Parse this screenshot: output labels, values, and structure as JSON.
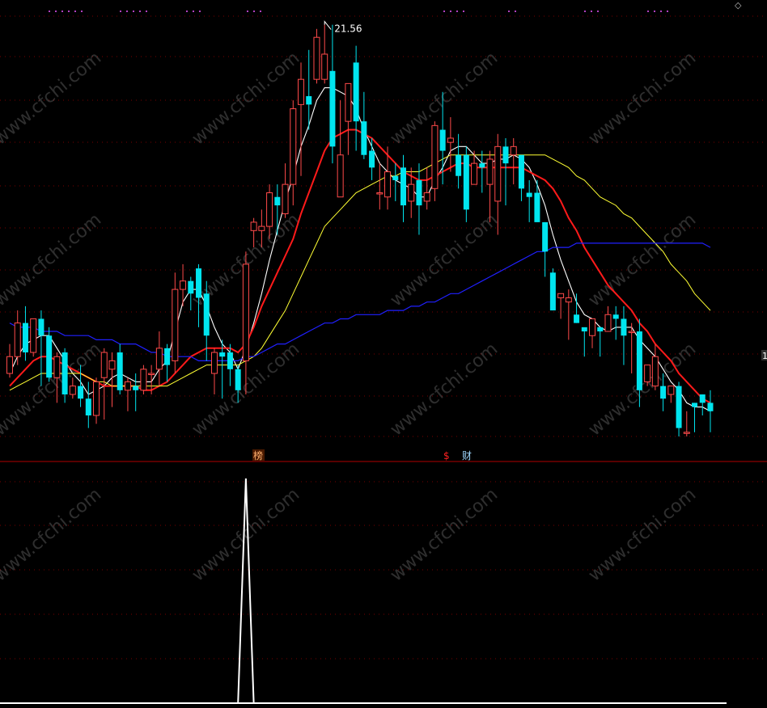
{
  "header": {
    "corner_icon": "diamond-icon"
  },
  "colors": {
    "background": "#000000",
    "up_candle": "#ff4a4a",
    "down_candle": "#00e5ef",
    "ma_fast": "#ffffff",
    "ma_mid": "#ff1a1a",
    "ma_slow": "#ffff33",
    "ma_long": "#2020ff",
    "grid": "#7a0000",
    "signal_line": "#ffffff",
    "marker_bang": "#ff6060",
    "marker_dollar": "#ff2020",
    "marker_cai": "#00e5ef",
    "watermark": "#ffffff"
  },
  "markers": {
    "bang": "榜",
    "dollar": "$",
    "cai": "财",
    "right_edge": "1"
  },
  "watermark": {
    "text": "www.cfchi.com"
  },
  "chart_data": [
    {
      "type": "candlestick",
      "title": "",
      "ylim": [
        11.8,
        21.9
      ],
      "peak_label": "21.56",
      "candles": [
        [
          13.3,
          13.7,
          13.2,
          14.0
        ],
        [
          13.7,
          14.5,
          13.5,
          14.8
        ],
        [
          14.5,
          13.8,
          13.6,
          14.9
        ],
        [
          13.8,
          14.6,
          13.7,
          14.6
        ],
        [
          14.6,
          14.2,
          13.0,
          14.8
        ],
        [
          14.2,
          13.2,
          13.1,
          14.4
        ],
        [
          13.2,
          13.7,
          12.6,
          13.8
        ],
        [
          13.8,
          12.8,
          12.6,
          13.9
        ],
        [
          12.8,
          13.0,
          12.7,
          13.2
        ],
        [
          13.0,
          12.7,
          12.5,
          13.5
        ],
        [
          12.7,
          12.3,
          12.0,
          13.1
        ],
        [
          12.3,
          13.1,
          12.1,
          13.2
        ],
        [
          13.2,
          13.8,
          12.2,
          13.9
        ],
        [
          13.4,
          13.6,
          12.5,
          13.8
        ],
        [
          13.8,
          12.9,
          12.8,
          14.0
        ],
        [
          12.9,
          13.1,
          12.4,
          13.2
        ],
        [
          13.0,
          12.9,
          12.4,
          13.3
        ],
        [
          12.9,
          13.4,
          12.8,
          13.5
        ],
        [
          13.3,
          13.3,
          12.8,
          13.5
        ],
        [
          13.4,
          13.9,
          13.0,
          14.3
        ],
        [
          13.9,
          13.5,
          13.1,
          14.0
        ],
        [
          13.6,
          15.3,
          13.3,
          15.7
        ],
        [
          15.3,
          15.5,
          14.9,
          15.9
        ],
        [
          15.5,
          15.2,
          14.8,
          15.6
        ],
        [
          15.8,
          15.1,
          14.4,
          15.9
        ],
        [
          15.2,
          14.2,
          13.6,
          15.5
        ],
        [
          13.3,
          13.8,
          12.8,
          13.9
        ],
        [
          13.8,
          13.7,
          12.7,
          14.1
        ],
        [
          13.8,
          13.4,
          13.0,
          14.0
        ],
        [
          13.4,
          12.9,
          12.6,
          13.5
        ],
        [
          13.6,
          15.9,
          12.8,
          16.2
        ],
        [
          16.7,
          16.9,
          16.3,
          17.0
        ],
        [
          16.7,
          16.8,
          16.3,
          17.2
        ],
        [
          16.8,
          17.6,
          16.5,
          17.8
        ],
        [
          17.5,
          17.3,
          16.6,
          17.8
        ],
        [
          17.1,
          17.8,
          17.0,
          18.3
        ],
        [
          17.8,
          19.6,
          17.3,
          19.8
        ],
        [
          19.7,
          20.3,
          18.0,
          20.7
        ],
        [
          19.9,
          19.7,
          19.1,
          21.0
        ],
        [
          20.3,
          21.3,
          20.2,
          21.5
        ],
        [
          20.3,
          20.9,
          20.2,
          21.6
        ],
        [
          20.5,
          18.7,
          18.3,
          21.6
        ],
        [
          17.5,
          18.5,
          17.5,
          19.8
        ],
        [
          19.3,
          20.2,
          18.5,
          20.2
        ],
        [
          20.7,
          19.3,
          18.6,
          21.1
        ],
        [
          19.3,
          18.5,
          18.4,
          20.0
        ],
        [
          18.6,
          18.2,
          17.9,
          18.9
        ],
        [
          17.6,
          17.6,
          17.2,
          18.3
        ],
        [
          17.5,
          18.1,
          17.2,
          18.7
        ],
        [
          18.0,
          17.9,
          17.4,
          18.3
        ],
        [
          18.2,
          17.3,
          16.9,
          18.5
        ],
        [
          17.4,
          17.8,
          17.0,
          18.2
        ],
        [
          17.9,
          17.3,
          16.6,
          18.3
        ],
        [
          17.4,
          17.6,
          17.2,
          18.2
        ],
        [
          17.7,
          19.2,
          17.4,
          19.3
        ],
        [
          19.1,
          18.6,
          17.8,
          20.0
        ],
        [
          18.8,
          18.9,
          18.1,
          19.4
        ],
        [
          18.5,
          18.0,
          17.7,
          19.0
        ],
        [
          18.5,
          17.2,
          16.9,
          18.7
        ],
        [
          17.8,
          18.3,
          17.8,
          18.6
        ],
        [
          18.3,
          18.2,
          17.6,
          18.6
        ],
        [
          17.8,
          18.4,
          16.9,
          18.6
        ],
        [
          17.4,
          18.7,
          16.6,
          19.0
        ],
        [
          18.7,
          18.3,
          17.3,
          18.9
        ],
        [
          18.5,
          18.7,
          17.8,
          18.9
        ],
        [
          18.5,
          17.7,
          17.4,
          18.3
        ],
        [
          17.6,
          17.5,
          16.9,
          17.9
        ],
        [
          17.6,
          16.9,
          16.9,
          17.9
        ],
        [
          16.9,
          16.2,
          15.6,
          16.9
        ],
        [
          15.7,
          14.8,
          14.8,
          15.8
        ],
        [
          15.1,
          15.2,
          14.6,
          15.2
        ],
        [
          15.0,
          15.1,
          14.1,
          15.3
        ],
        [
          14.7,
          14.5,
          14.5,
          15.2
        ],
        [
          14.4,
          14.3,
          13.7,
          14.3
        ],
        [
          14.2,
          14.6,
          13.9,
          14.3
        ],
        [
          14.4,
          14.3,
          13.7,
          14.4
        ],
        [
          14.3,
          14.7,
          14.5,
          14.9
        ],
        [
          14.7,
          14.6,
          14.1,
          14.9
        ],
        [
          14.6,
          14.2,
          13.5,
          14.9
        ],
        [
          14.3,
          14.3,
          13.3,
          14.5
        ],
        [
          14.3,
          12.9,
          12.5,
          14.6
        ],
        [
          13.1,
          13.5,
          13.0,
          13.5
        ],
        [
          13.0,
          13.7,
          12.9,
          14.0
        ],
        [
          13.0,
          12.7,
          12.4,
          13.3
        ],
        [
          12.8,
          13.0,
          12.6,
          12.9
        ],
        [
          13.0,
          12.0,
          11.8,
          13.1
        ],
        [
          11.9,
          11.9,
          11.8,
          12.4
        ],
        [
          12.6,
          12.5,
          11.9,
          12.6
        ],
        [
          12.8,
          12.6,
          12.3,
          12.8
        ],
        [
          12.6,
          12.4,
          11.9,
          12.9
        ]
      ],
      "series": [
        {
          "color_key": "ma_fast",
          "values": [
            13.3,
            13.7,
            14.0,
            14.1,
            14.2,
            14.2,
            13.9,
            13.6,
            13.3,
            13.1,
            12.8,
            12.9,
            13.0,
            13.2,
            13.3,
            13.2,
            13.1,
            13.1,
            13.1,
            13.4,
            13.6,
            14.3,
            15.0,
            15.3,
            15.3,
            14.9,
            14.4,
            14.0,
            13.8,
            13.4,
            13.9,
            14.5,
            15.2,
            16.0,
            16.7,
            17.4,
            18.0,
            18.7,
            19.2,
            19.8,
            20.1,
            20.1,
            20.0,
            19.9,
            19.6,
            19.1,
            18.7,
            18.3,
            18.1,
            17.9,
            17.8,
            17.7,
            17.5,
            17.5,
            17.9,
            18.2,
            18.6,
            18.7,
            18.7,
            18.5,
            18.3,
            18.3,
            18.4,
            18.4,
            18.5,
            18.4,
            18.2,
            17.8,
            17.3,
            16.6,
            16.0,
            15.5,
            15.0,
            14.7,
            14.6,
            14.4,
            14.3,
            14.4,
            14.4,
            14.4,
            14.1,
            13.9,
            13.7,
            13.4,
            13.1,
            12.9,
            12.6,
            12.5,
            12.5,
            12.4
          ]
        },
        {
          "color_key": "ma_mid",
          "values": [
            13.0,
            13.2,
            13.4,
            13.6,
            13.7,
            13.7,
            13.6,
            13.5,
            13.4,
            13.3,
            13.2,
            13.1,
            13.0,
            13.0,
            13.0,
            13.0,
            13.0,
            12.9,
            12.9,
            13.0,
            13.1,
            13.3,
            13.5,
            13.7,
            13.8,
            13.9,
            13.9,
            13.9,
            13.9,
            13.8,
            14.0,
            14.4,
            14.9,
            15.3,
            15.7,
            16.1,
            16.5,
            17.1,
            17.6,
            18.1,
            18.6,
            18.9,
            19.0,
            19.1,
            19.1,
            19.0,
            18.9,
            18.7,
            18.5,
            18.3,
            18.1,
            18.0,
            17.9,
            17.9,
            18.0,
            18.1,
            18.2,
            18.3,
            18.3,
            18.2,
            18.2,
            18.2,
            18.2,
            18.2,
            18.2,
            18.2,
            18.1,
            18.0,
            17.9,
            17.7,
            17.4,
            17.0,
            16.7,
            16.3,
            16.0,
            15.7,
            15.4,
            15.2,
            15.0,
            14.8,
            14.5,
            14.3,
            14.0,
            13.8,
            13.6,
            13.3,
            13.1,
            12.9,
            12.7,
            12.6
          ]
        },
        {
          "color_key": "ma_slow",
          "values": [
            12.9,
            13.0,
            13.1,
            13.2,
            13.3,
            13.3,
            13.3,
            13.3,
            13.3,
            13.3,
            13.2,
            13.1,
            13.1,
            13.0,
            13.0,
            13.0,
            13.0,
            13.0,
            13.0,
            13.0,
            13.0,
            13.1,
            13.2,
            13.3,
            13.4,
            13.5,
            13.5,
            13.5,
            13.5,
            13.5,
            13.6,
            13.7,
            13.9,
            14.2,
            14.5,
            14.8,
            15.2,
            15.6,
            16.0,
            16.4,
            16.8,
            17.0,
            17.2,
            17.4,
            17.6,
            17.7,
            17.8,
            17.9,
            18.0,
            18.0,
            18.1,
            18.1,
            18.1,
            18.2,
            18.3,
            18.4,
            18.5,
            18.5,
            18.5,
            18.5,
            18.5,
            18.5,
            18.5,
            18.5,
            18.5,
            18.5,
            18.5,
            18.5,
            18.5,
            18.4,
            18.3,
            18.2,
            18.0,
            17.9,
            17.7,
            17.5,
            17.4,
            17.3,
            17.1,
            17.0,
            16.8,
            16.6,
            16.4,
            16.2,
            15.9,
            15.7,
            15.5,
            15.2,
            15.0,
            14.8
          ]
        },
        {
          "color_key": "ma_long",
          "values": [
            14.5,
            14.4,
            14.4,
            14.4,
            14.3,
            14.3,
            14.3,
            14.2,
            14.2,
            14.2,
            14.2,
            14.1,
            14.1,
            14.1,
            14.0,
            14.0,
            14.0,
            13.9,
            13.8,
            13.8,
            13.7,
            13.7,
            13.7,
            13.7,
            13.6,
            13.6,
            13.6,
            13.6,
            13.6,
            13.6,
            13.7,
            13.7,
            13.8,
            13.9,
            14.0,
            14.0,
            14.1,
            14.2,
            14.3,
            14.4,
            14.5,
            14.5,
            14.6,
            14.6,
            14.7,
            14.7,
            14.7,
            14.7,
            14.8,
            14.8,
            14.8,
            14.9,
            14.9,
            15.0,
            15.0,
            15.1,
            15.2,
            15.2,
            15.3,
            15.4,
            15.5,
            15.6,
            15.7,
            15.8,
            15.9,
            16.0,
            16.1,
            16.2,
            16.2,
            16.3,
            16.3,
            16.3,
            16.4,
            16.4,
            16.4,
            16.4,
            16.4,
            16.4,
            16.4,
            16.4,
            16.4,
            16.4,
            16.4,
            16.4,
            16.4,
            16.4,
            16.4,
            16.4,
            16.4,
            16.3
          ]
        }
      ]
    },
    {
      "type": "line",
      "title": "",
      "ylim": [
        0,
        1
      ],
      "series": [
        {
          "color_key": "signal_line",
          "values": [
            0,
            0,
            0,
            0,
            0,
            0,
            0,
            0,
            0,
            0,
            0,
            0,
            0,
            0,
            0,
            0,
            0,
            0,
            0,
            0,
            0,
            0,
            0,
            0,
            0,
            0,
            0,
            0,
            0,
            0,
            1,
            0,
            0,
            0,
            0,
            0,
            0,
            0,
            0,
            0,
            0,
            0,
            0,
            0,
            0,
            0,
            0,
            0,
            0,
            0,
            0,
            0,
            0,
            0,
            0,
            0,
            0,
            0,
            0,
            0,
            0,
            0,
            0,
            0,
            0,
            0,
            0,
            0,
            0,
            0,
            0,
            0,
            0,
            0,
            0,
            0,
            0,
            0,
            0,
            0,
            0,
            0,
            0,
            0,
            0,
            0,
            0,
            0,
            0,
            0
          ]
        }
      ]
    }
  ]
}
